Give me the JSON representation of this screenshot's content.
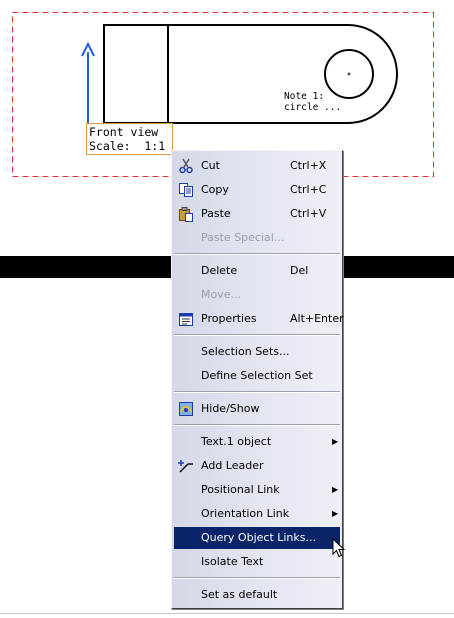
{
  "drawing": {
    "view_label_line1": "Front view",
    "view_label_line2": "Scale:  1:1",
    "note_line1": "Note 1:",
    "note_line2": "circle ..."
  },
  "menu": {
    "cut": {
      "label": "Cut",
      "shortcut": "Ctrl+X"
    },
    "copy": {
      "label": "Copy",
      "shortcut": "Ctrl+C"
    },
    "paste": {
      "label": "Paste",
      "shortcut": "Ctrl+V"
    },
    "paste_special": {
      "label": "Paste Special..."
    },
    "delete": {
      "label": "Delete",
      "shortcut": "Del"
    },
    "move": {
      "label": "Move..."
    },
    "properties": {
      "label": "Properties",
      "shortcut": "Alt+Enter"
    },
    "selection_sets": {
      "label": "Selection Sets..."
    },
    "define_selection_set": {
      "label": "Define Selection Set"
    },
    "hide_show": {
      "label": "Hide/Show"
    },
    "text_object": {
      "label": "Text.1 object"
    },
    "add_leader": {
      "label": "Add Leader"
    },
    "positional_link": {
      "label": "Positional Link"
    },
    "orientation_link": {
      "label": "Orientation Link"
    },
    "query_object_links": {
      "label": "Query Object Links..."
    },
    "isolate_text": {
      "label": "Isolate Text"
    },
    "set_as_default": {
      "label": "Set as default"
    }
  },
  "colors": {
    "menu_highlight": "#0a246a",
    "frame_dash": "#e03030",
    "axis_blue": "#1f5fe0",
    "label_border": "#d89a3a"
  }
}
